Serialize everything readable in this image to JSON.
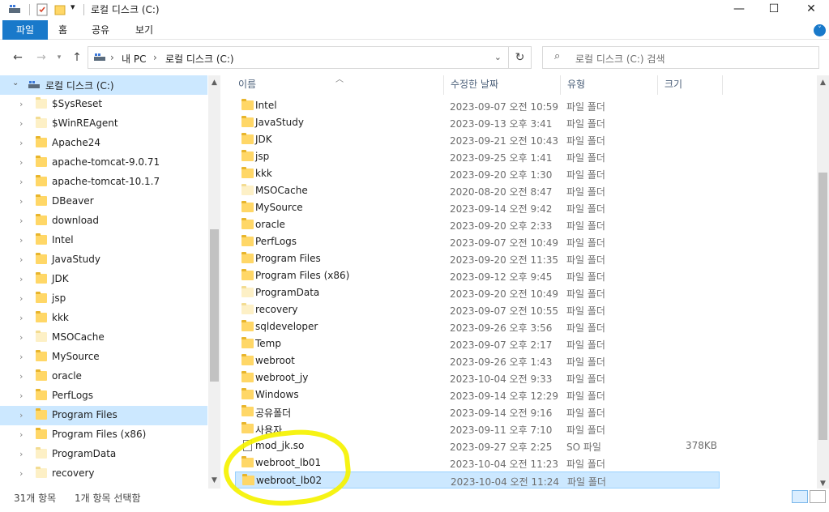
{
  "window": {
    "title": "로컬 디스크 (C:)",
    "minimize_glyph": "—",
    "maximize_glyph": "☐",
    "close_glyph": "✕"
  },
  "ribbon": {
    "tabs": [
      "파일",
      "홈",
      "공유",
      "보기"
    ],
    "expand_glyph": "˅"
  },
  "address": {
    "breadcrumb": [
      "내 PC",
      "로컬 디스크 (C:)"
    ],
    "search_placeholder": "로컬 디스크 (C:) 검색"
  },
  "nav_pane": {
    "root": "로컬 디스크 (C:)",
    "items": [
      {
        "label": "$SysReset",
        "pale": true
      },
      {
        "label": "$WinREAgent",
        "pale": true
      },
      {
        "label": "Apache24",
        "pale": false
      },
      {
        "label": "apache-tomcat-9.0.71",
        "pale": false
      },
      {
        "label": "apache-tomcat-10.1.7",
        "pale": false
      },
      {
        "label": "DBeaver",
        "pale": false
      },
      {
        "label": "download",
        "pale": false
      },
      {
        "label": "Intel",
        "pale": false
      },
      {
        "label": "JavaStudy",
        "pale": false
      },
      {
        "label": "JDK",
        "pale": false
      },
      {
        "label": "jsp",
        "pale": false
      },
      {
        "label": "kkk",
        "pale": false
      },
      {
        "label": "MSOCache",
        "pale": true
      },
      {
        "label": "MySource",
        "pale": false
      },
      {
        "label": "oracle",
        "pale": false
      },
      {
        "label": "PerfLogs",
        "pale": false
      },
      {
        "label": "Program Files",
        "pale": false,
        "selected": true
      },
      {
        "label": "Program Files (x86)",
        "pale": false
      },
      {
        "label": "ProgramData",
        "pale": true
      },
      {
        "label": "recovery",
        "pale": true
      }
    ]
  },
  "columns": {
    "name": "이름",
    "modified": "수정한 날짜",
    "type": "유형",
    "size": "크기"
  },
  "files": [
    {
      "name": "Intel",
      "modified": "2023-09-07 오전 10:59",
      "type": "파일 폴더",
      "size": "",
      "kind": "folder"
    },
    {
      "name": "JavaStudy",
      "modified": "2023-09-13 오후 3:41",
      "type": "파일 폴더",
      "size": "",
      "kind": "folder"
    },
    {
      "name": "JDK",
      "modified": "2023-09-21 오전 10:43",
      "type": "파일 폴더",
      "size": "",
      "kind": "folder"
    },
    {
      "name": "jsp",
      "modified": "2023-09-25 오후 1:41",
      "type": "파일 폴더",
      "size": "",
      "kind": "folder"
    },
    {
      "name": "kkk",
      "modified": "2023-09-20 오후 1:30",
      "type": "파일 폴더",
      "size": "",
      "kind": "folder"
    },
    {
      "name": "MSOCache",
      "modified": "2020-08-20 오전 8:47",
      "type": "파일 폴더",
      "size": "",
      "kind": "folder-pale"
    },
    {
      "name": "MySource",
      "modified": "2023-09-14 오전 9:42",
      "type": "파일 폴더",
      "size": "",
      "kind": "folder"
    },
    {
      "name": "oracle",
      "modified": "2023-09-20 오후 2:33",
      "type": "파일 폴더",
      "size": "",
      "kind": "folder"
    },
    {
      "name": "PerfLogs",
      "modified": "2023-09-07 오전 10:49",
      "type": "파일 폴더",
      "size": "",
      "kind": "folder"
    },
    {
      "name": "Program Files",
      "modified": "2023-09-20 오전 11:35",
      "type": "파일 폴더",
      "size": "",
      "kind": "folder"
    },
    {
      "name": "Program Files (x86)",
      "modified": "2023-09-12 오후 9:45",
      "type": "파일 폴더",
      "size": "",
      "kind": "folder"
    },
    {
      "name": "ProgramData",
      "modified": "2023-09-20 오전 10:49",
      "type": "파일 폴더",
      "size": "",
      "kind": "folder-pale"
    },
    {
      "name": "recovery",
      "modified": "2023-09-07 오전 10:55",
      "type": "파일 폴더",
      "size": "",
      "kind": "folder-pale"
    },
    {
      "name": "sqldeveloper",
      "modified": "2023-09-26 오후 3:56",
      "type": "파일 폴더",
      "size": "",
      "kind": "folder"
    },
    {
      "name": "Temp",
      "modified": "2023-09-07 오후 2:17",
      "type": "파일 폴더",
      "size": "",
      "kind": "folder"
    },
    {
      "name": "webroot",
      "modified": "2023-09-26 오후 1:43",
      "type": "파일 폴더",
      "size": "",
      "kind": "folder"
    },
    {
      "name": "webroot_jy",
      "modified": "2023-10-04 오전 9:33",
      "type": "파일 폴더",
      "size": "",
      "kind": "folder"
    },
    {
      "name": "Windows",
      "modified": "2023-09-14 오후 12:29",
      "type": "파일 폴더",
      "size": "",
      "kind": "folder"
    },
    {
      "name": "공유폴더",
      "modified": "2023-09-14 오전 9:16",
      "type": "파일 폴더",
      "size": "",
      "kind": "folder"
    },
    {
      "name": "사용자",
      "modified": "2023-09-11 오후 7:10",
      "type": "파일 폴더",
      "size": "",
      "kind": "folder"
    },
    {
      "name": "mod_jk.so",
      "modified": "2023-09-27 오후 2:25",
      "type": "SO 파일",
      "size": "378KB",
      "kind": "file"
    },
    {
      "name": "webroot_lb01",
      "modified": "2023-10-04 오전 11:23",
      "type": "파일 폴더",
      "size": "",
      "kind": "folder"
    },
    {
      "name": "webroot_lb02",
      "modified": "2023-10-04 오전 11:24",
      "type": "파일 폴더",
      "size": "",
      "kind": "folder",
      "selected": true
    }
  ],
  "status": {
    "item_count": "31개 항목",
    "selected_count": "1개 항목 선택함"
  },
  "colors": {
    "accent": "#1979ca",
    "selection": "#cce8ff",
    "highlight_marker": "#f5f200"
  }
}
